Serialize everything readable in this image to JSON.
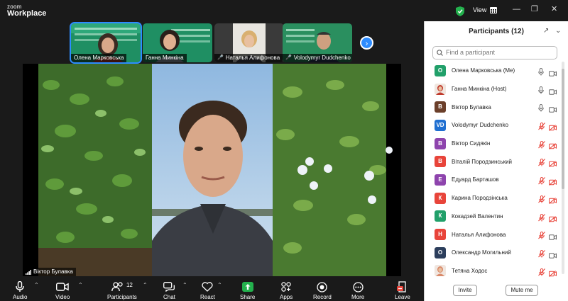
{
  "app": {
    "logo_top": "zoom",
    "logo_bottom": "Workplace"
  },
  "topbar": {
    "view_label": "View"
  },
  "thumbnails": [
    {
      "name": "Олена Марковська",
      "muted": false
    },
    {
      "name": "Ганна Минкіна",
      "muted": false
    },
    {
      "name": "Наталья Алифонова",
      "muted": true
    },
    {
      "name": "Volodymyr Dudchenko",
      "muted": true
    }
  ],
  "active_speaker": "Віктор Булавка",
  "toolbar": {
    "audio": "Audio",
    "video": "Video",
    "participants": "Participants",
    "participants_count": "12",
    "chat": "Chat",
    "react": "React",
    "share": "Share",
    "apps": "Apps",
    "record": "Record",
    "more": "More",
    "leave": "Leave"
  },
  "panel": {
    "title": "Participants (12)",
    "search_placeholder": "Find a participant",
    "invite": "Invite",
    "mute_me": "Mute me",
    "participants": [
      {
        "initials": "О",
        "name": "Олена Марковська (Me)",
        "color": "#21a06a",
        "mic": "on",
        "cam": "on"
      },
      {
        "initials": "",
        "name": "Ганна Минкіна (Host)",
        "color": "#c0392b",
        "photo": true,
        "mic": "on",
        "cam": "on"
      },
      {
        "initials": "В",
        "name": "Віктор Булавка",
        "color": "#6b3f2a",
        "mic": "on",
        "cam": "on"
      },
      {
        "initials": "VD",
        "name": "Volodymyr Dudchenko",
        "color": "#1f6fd1",
        "mic": "off",
        "cam": "off"
      },
      {
        "initials": "В",
        "name": "Віктор Сидякін",
        "color": "#8e44ad",
        "mic": "off",
        "cam": "off"
      },
      {
        "initials": "В",
        "name": "Віталій Породзинський",
        "color": "#e8443a",
        "mic": "off",
        "cam": "off"
      },
      {
        "initials": "Е",
        "name": "Едуард Барташов",
        "color": "#8e44ad",
        "mic": "off",
        "cam": "off"
      },
      {
        "initials": "К",
        "name": "Карина Породзінська",
        "color": "#e8443a",
        "mic": "off",
        "cam": "off"
      },
      {
        "initials": "К",
        "name": "Кокадзей Валентин",
        "color": "#21a06a",
        "mic": "off",
        "cam": "off"
      },
      {
        "initials": "Н",
        "name": "Наталья Алифонова",
        "color": "#e8443a",
        "mic": "off",
        "cam": "on"
      },
      {
        "initials": "О",
        "name": "Олександр Могильний",
        "color": "#2c3e5c",
        "mic": "off",
        "cam": "on"
      },
      {
        "initials": "",
        "name": "Тетяна Ходос",
        "color": "#d98a6a",
        "photo": true,
        "mic": "off",
        "cam": "off"
      }
    ]
  }
}
